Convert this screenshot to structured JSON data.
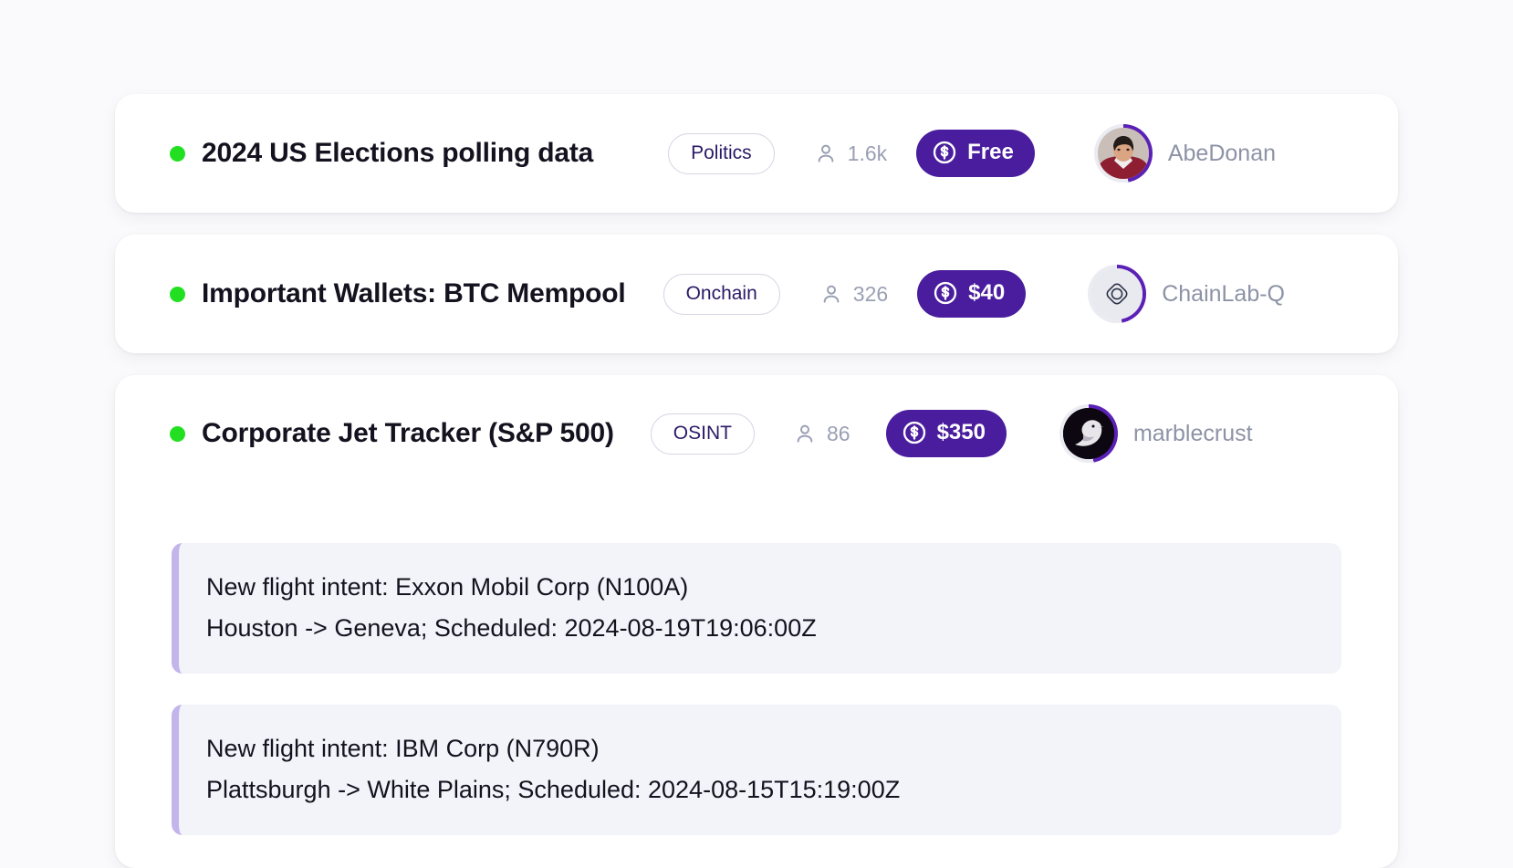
{
  "theme": {
    "page_background": "#fafafc",
    "card_background": "#ffffff",
    "accent_purple": "#4a1d9e",
    "status_green": "#22e021",
    "message_background": "#f3f4f9",
    "message_accent": "#c3b5ec",
    "muted_text": "#8d93a6"
  },
  "feed": {
    "items": [
      {
        "status": "online",
        "title": "2024 US Elections polling data",
        "tag": "Politics",
        "subscribers": "1.6k",
        "subscribers_icon": "person-icon",
        "price": "Free",
        "price_icon": "dollar-coin-icon",
        "author": "AbeDonan",
        "avatar_kind": "photo-portrait"
      },
      {
        "status": "online",
        "title": "Important Wallets: BTC Mempool",
        "tag": "Onchain",
        "subscribers": "326",
        "subscribers_icon": "person-icon",
        "price": "$40",
        "price_icon": "dollar-coin-icon",
        "author": "ChainLab-Q",
        "avatar_kind": "logo-diamond"
      },
      {
        "status": "online",
        "title": "Corporate Jet Tracker (S&P 500)",
        "tag": "OSINT",
        "subscribers": "86",
        "subscribers_icon": "person-icon",
        "price": "$350",
        "price_icon": "dollar-coin-icon",
        "author": "marblecrust",
        "avatar_kind": "dark-bird"
      }
    ],
    "messages": [
      {
        "line1": "New flight intent: Exxon Mobil Corp (N100A)",
        "line2": "Houston -> Geneva; Scheduled: 2024-08-19T19:06:00Z"
      },
      {
        "line1": "New flight intent: IBM Corp (N790R)",
        "line2": "Plattsburgh -> White Plains; Scheduled: 2024-08-15T15:19:00Z"
      }
    ]
  }
}
